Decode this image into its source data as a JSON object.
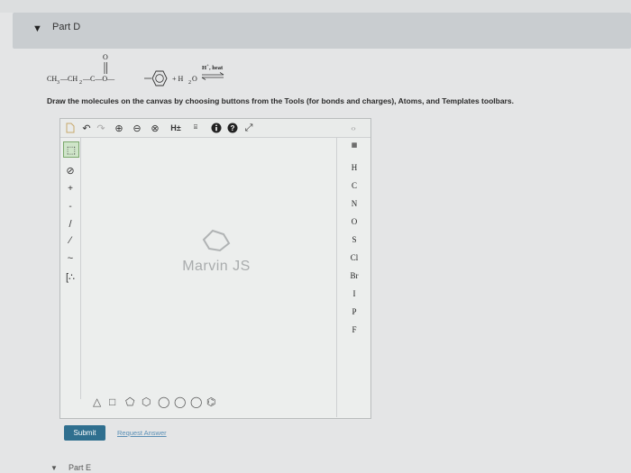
{
  "part_d": {
    "title": "Part D"
  },
  "reaction": {
    "reactant_left": "CH",
    "reactant_left_sub": "3",
    "dash1": "—CH",
    "reactant_mid_sub": "2",
    "carbonyl": "—C—O—",
    "oxygen_top": "O",
    "plus_water": "+ H",
    "water_sub": "2",
    "water_o": "O",
    "condition": "H",
    "condition_sup": "+",
    "condition_rest": ", heat"
  },
  "instruction": "Draw the molecules on the canvas by choosing buttons from the Tools (for bonds and charges), Atoms, and Templates toolbars.",
  "editor": {
    "watermark": "Marvin JS",
    "atoms": [
      "H",
      "C",
      "N",
      "O",
      "S",
      "Cl",
      "Br",
      "I",
      "P",
      "F"
    ]
  },
  "actions": {
    "submit": "Submit",
    "request": "Request Answer"
  },
  "part_e": {
    "title": "Part E"
  },
  "colors": {
    "submit": "#2f6f8f",
    "link": "#5a8fb5",
    "header": "#c9cdd0"
  }
}
